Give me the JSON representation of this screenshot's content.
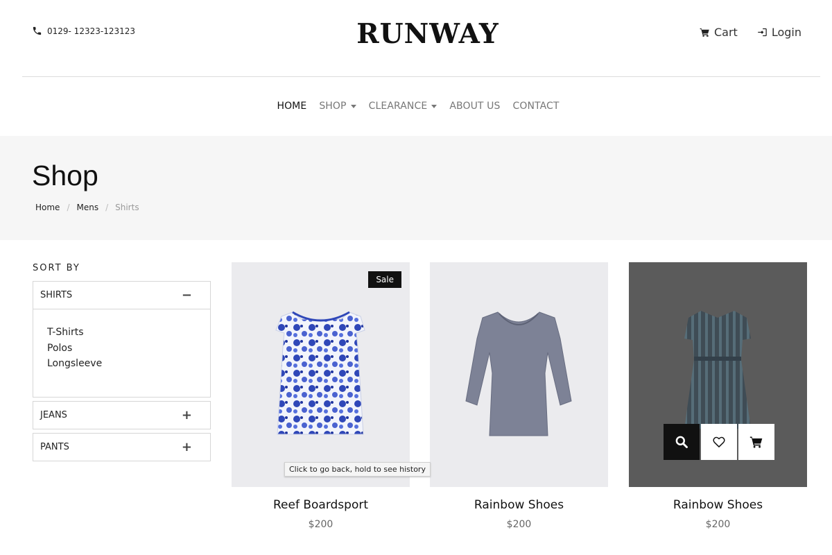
{
  "header": {
    "phone": "0129- 12323-123123",
    "logo": "RUNWAY",
    "cart_label": "Cart",
    "login_label": "Login"
  },
  "nav": {
    "items": [
      {
        "label": "HOME",
        "active": true
      },
      {
        "label": "SHOP",
        "dropdown": true
      },
      {
        "label": "CLEARANCE",
        "dropdown": true
      },
      {
        "label": "ABOUT US"
      },
      {
        "label": "CONTACT"
      }
    ]
  },
  "hero": {
    "title": "Shop",
    "breadcrumb": [
      "Home",
      "Mens",
      "Shirts"
    ]
  },
  "sidebar": {
    "title": "SORT BY",
    "filters": [
      {
        "label": "SHIRTS",
        "expanded": true,
        "toggle": "−",
        "items": [
          "T-Shirts",
          "Polos",
          "Longsleeve"
        ]
      },
      {
        "label": "JEANS",
        "expanded": false,
        "toggle": "+"
      },
      {
        "label": "PANTS",
        "expanded": false,
        "toggle": "+"
      }
    ]
  },
  "products": [
    {
      "name": "Reef Boardsport",
      "price": "$200",
      "badge": "Sale"
    },
    {
      "name": "Rainbow Shoes",
      "price": "$200"
    },
    {
      "name": "Rainbow Shoes",
      "price": "$200"
    }
  ],
  "tooltip": "Click to go back, hold to see history",
  "colors": {
    "hero_bg": "#f6f6f6",
    "card_bg": "#ebebee",
    "overlay_bg": "#5b5b5b",
    "accent": "#111111"
  }
}
